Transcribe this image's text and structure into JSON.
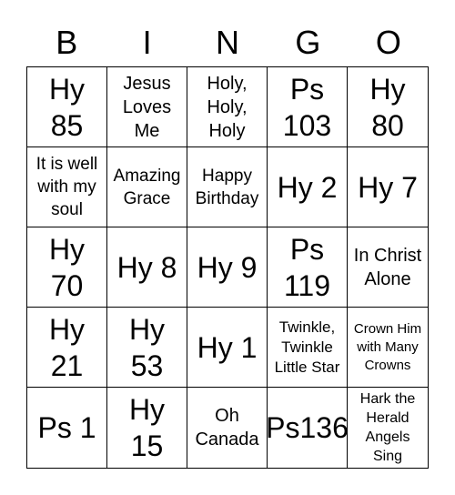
{
  "header": [
    "B",
    "I",
    "N",
    "G",
    "O"
  ],
  "cells": [
    [
      "Hy 85",
      "Jesus Loves Me",
      "Holy, Holy, Holy",
      "Ps 103",
      "Hy 80"
    ],
    [
      "It is well with my soul",
      "Amazing Grace",
      "Happy Birthday",
      "Hy 2",
      "Hy 7"
    ],
    [
      "Hy 70",
      "Hy 8",
      "Hy 9",
      "Ps 119",
      "In Christ Alone"
    ],
    [
      "Hy 21",
      "Hy 53",
      "Hy 1",
      "Twinkle, Twinkle Little Star",
      "Crown Him with Many Crowns"
    ],
    [
      "Ps 1",
      "Hy 15",
      "Oh Canada",
      "Ps136",
      "Hark the Herald Angels Sing"
    ]
  ]
}
